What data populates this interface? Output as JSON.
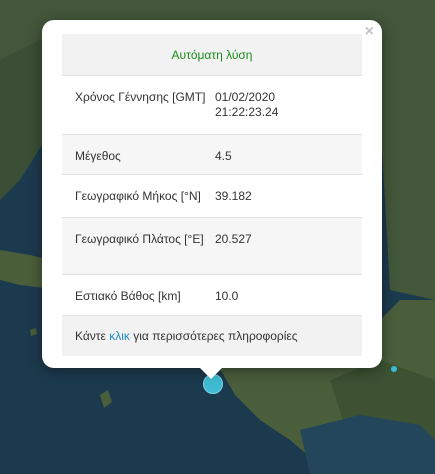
{
  "popup": {
    "header": "Αυτόματη λύση",
    "rows": [
      {
        "label": "Χρόνος Γέννησης [GMT]",
        "value_line1": "01/02/2020",
        "value_line2": "21:22:23.24"
      },
      {
        "label": "Μέγεθος",
        "value_line1": "4.5",
        "value_line2": ""
      },
      {
        "label": "Γεωγραφικό Μήκος [°N]",
        "value_line1": "39.182",
        "value_line2": ""
      },
      {
        "label": "Γεωγραφικό Πλάτος [°E]",
        "value_line1": "20.527",
        "value_line2": ""
      },
      {
        "label": "Εστιακό Βάθος [km]",
        "value_line1": "10.0",
        "value_line2": ""
      }
    ],
    "footer": {
      "prefix": "Κάντε",
      "link": "κλικ",
      "suffix": "για περισσότερες πληροφορίες"
    },
    "close_label": "×"
  },
  "colors": {
    "header_text": "#1a8a1a",
    "link": "#1f8ac0",
    "marker": "#3fbcd4",
    "sea": "#1d3a4c",
    "land": "#3f5a33"
  }
}
